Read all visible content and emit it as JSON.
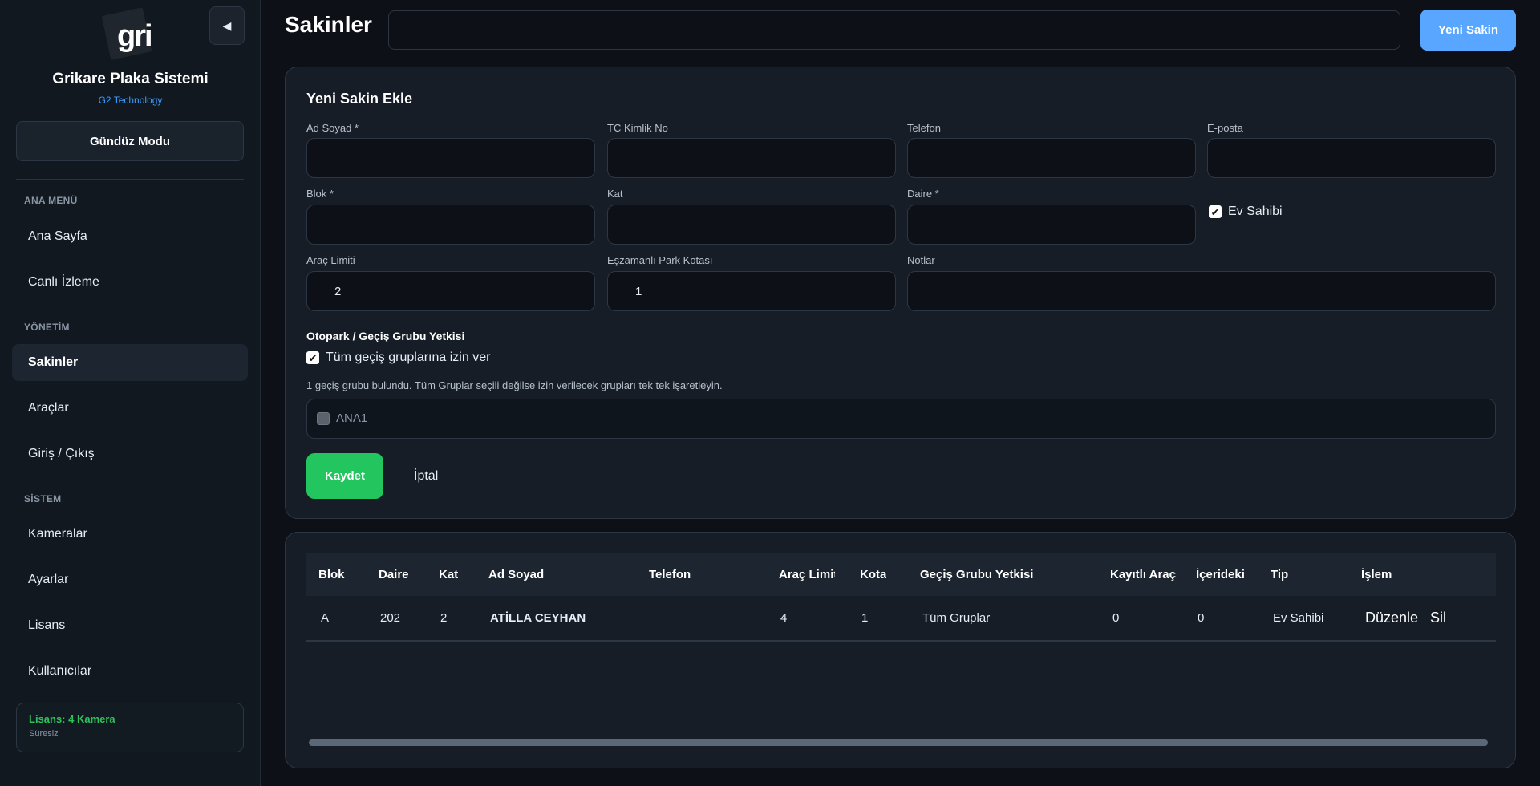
{
  "app": {
    "logo_text": "gri",
    "title": "Grikare Plaka Sistemi",
    "subtitle": "G2 Technology",
    "mode_button": "Gündüz Modu"
  },
  "sidebar": {
    "sections": [
      {
        "label": "ANA MENÜ",
        "items": [
          "Ana Sayfa",
          "Canlı İzleme"
        ]
      },
      {
        "label": "YÖNETİM",
        "items": [
          "Sakinler",
          "Araçlar",
          "Giriş / Çıkış"
        ]
      },
      {
        "label": "SİSTEM",
        "items": [
          "Kameralar",
          "Ayarlar",
          "Lisans",
          "Kullanıcılar"
        ]
      }
    ],
    "active_item": "Sakinler",
    "license": {
      "title": "Lisans: 4 Kamera",
      "subtitle": "Süresiz"
    }
  },
  "header": {
    "title": "Sakinler",
    "search_value": "",
    "new_button": "Yeni Sakin"
  },
  "form": {
    "title": "Yeni Sakin Ekle",
    "labels": {
      "full_name": "Ad Soyad *",
      "tc_no": "TC Kimlik No",
      "phone": "Telefon",
      "email": "E-posta",
      "block": "Blok *",
      "floor": "Kat",
      "apartment": "Daire *",
      "owner": "Ev Sahibi",
      "vehicle_limit": "Araç Limiti",
      "parking_quota": "Eşzamanlı Park Kotası",
      "notes": "Notlar"
    },
    "values": {
      "full_name": "",
      "tc_no": "",
      "phone": "",
      "email": "",
      "block": "",
      "floor": "",
      "apartment": "",
      "vehicle_limit": "2",
      "parking_quota": "1",
      "notes": ""
    },
    "owner_checked": true,
    "access_section_title": "Otopark / Geçiş Grubu Yetkisi",
    "allow_all_label": "Tüm geçiş gruplarına izin ver",
    "allow_all_checked": true,
    "help_text": "1 geçiş grubu bulundu. Tüm Gruplar seçili değilse izin verilecek grupları tek tek işaretleyin.",
    "groups": [
      {
        "name": "ANA1",
        "checked": false
      }
    ],
    "save_button": "Kaydet",
    "cancel_button": "İptal"
  },
  "table": {
    "headers": [
      "Blok",
      "Daire",
      "Kat",
      "Ad Soyad",
      "Telefon",
      "Araç Limiti",
      "Kota",
      "Geçiş Grubu Yetkisi",
      "Kayıtlı Araç",
      "İçerideki",
      "Tip",
      "İşlem"
    ],
    "rows": [
      {
        "block": "A",
        "apartment": "202",
        "floor": "2",
        "name": "ATİLLA CEYHAN",
        "phone": "",
        "vehicle_limit": "4",
        "quota": "1",
        "access": "Tüm Gruplar",
        "registered": "0",
        "inside": "0",
        "type": "Ev Sahibi",
        "edit": "Düzenle",
        "delete": "Sil"
      }
    ]
  },
  "colors": {
    "background": "#0d1117",
    "sidebar": "#111820",
    "card": "#161d26",
    "primary": "#58a6ff",
    "success": "#22c55e",
    "license_green": "#2fc25b",
    "accent_red": "#e5484d"
  },
  "icons": {
    "collapse": "triangle-left-icon",
    "checkbox": "checkmark-icon"
  }
}
